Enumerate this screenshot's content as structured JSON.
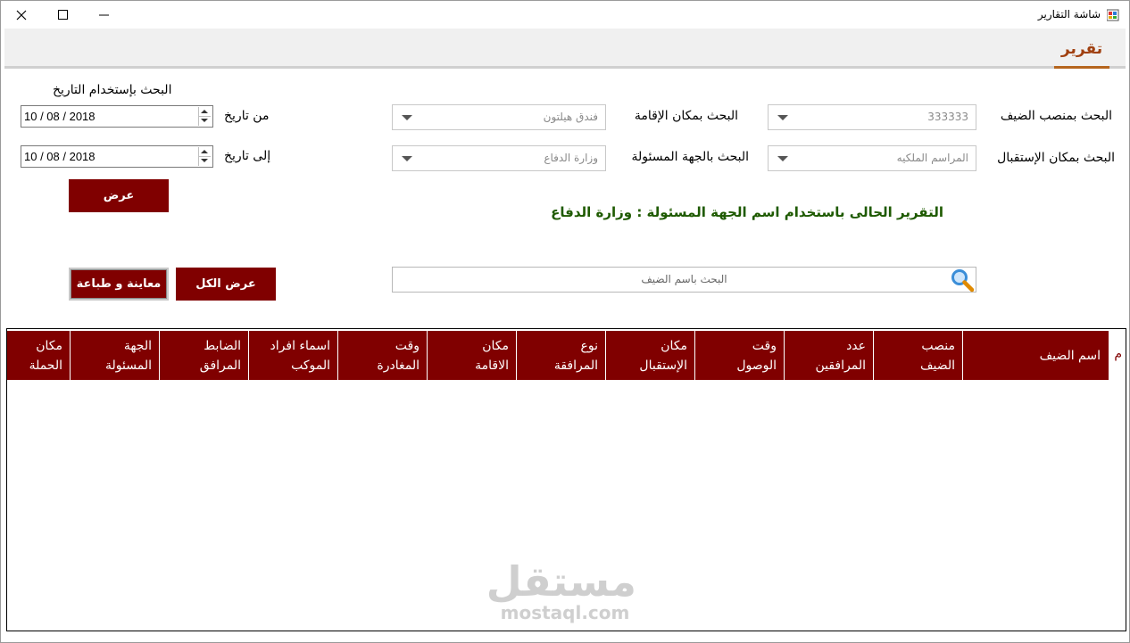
{
  "window": {
    "title": "شاشة التقارير",
    "controls": {
      "close_icon": "close-icon",
      "maximize_icon": "maximize-icon",
      "minimize_icon": "minimize-icon"
    }
  },
  "tabs": [
    {
      "label": "تقرير",
      "active": true
    }
  ],
  "date_search": {
    "heading": "البحث بإستخدام التاريخ",
    "from_label": "من تاريخ",
    "from_value": "10 / 08 / 2018",
    "to_label": "إلى تاريخ",
    "to_value": "10 / 08 / 2018"
  },
  "filters": {
    "guest_position": {
      "label": "البحث بمنصب الضيف",
      "value": "333333"
    },
    "residence_place": {
      "label": "البحث بمكان الإقامة",
      "value": "فندق هيلتون"
    },
    "reception_place": {
      "label": "البحث بمكان الإستقبال",
      "value": "المراسم الملكيه"
    },
    "responsible_party": {
      "label": "البحث بالجهة المسئولة",
      "value": "وزارة الدفاع"
    }
  },
  "buttons": {
    "show": "عرض",
    "show_all": "عرض الكل",
    "preview_print": "معاينة و طباعة"
  },
  "report_message": "التقرير الحالى باستخدام اسم الجهة المسئولة : وزارة الدفاع",
  "search": {
    "placeholder": "البحث باسم الضيف"
  },
  "table": {
    "row_num_header": "م",
    "columns": [
      "اسم الضيف",
      "منصب الضيف",
      "عدد المرافقين",
      "وقت الوصول",
      "مكان الإستقبال",
      "نوع المرافقة",
      "مكان الاقامة",
      "وقت المغادرة",
      "اسماء افراد الموكب",
      "الضابط المرافق",
      "الجهة المسئولة",
      "مكان الحملة"
    ],
    "rows": []
  },
  "watermark": {
    "arabic": "مستقل",
    "latin": "mostaql.com"
  },
  "colors": {
    "accent": "#800000",
    "message": "#1e5a00",
    "tab_accent": "#b5651d"
  }
}
